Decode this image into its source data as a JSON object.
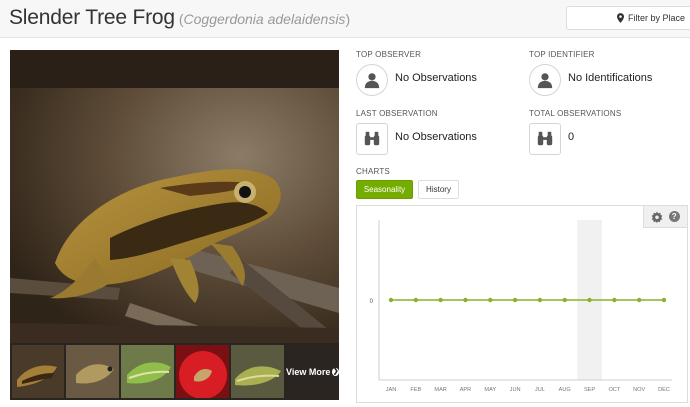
{
  "header": {
    "common_name": "Slender Tree Frog",
    "scientific_name": "Coggerdonia adelaidensis",
    "paren_open": "(",
    "paren_close": ")",
    "filter_label": "Filter by Place"
  },
  "photos": {
    "view_more": "View More",
    "thumbnail_count": 5
  },
  "stats": {
    "top_observer": {
      "label": "TOP OBSERVER",
      "value": "No Observations",
      "icon": "person-icon"
    },
    "top_identifier": {
      "label": "TOP IDENTIFIER",
      "value": "No Identifications",
      "icon": "person-icon"
    },
    "last_observation": {
      "label": "LAST OBSERVATION",
      "value": "No Observations",
      "icon": "binoculars-icon"
    },
    "total_observations": {
      "label": "TOTAL OBSERVATIONS",
      "value": "0",
      "icon": "binoculars-icon"
    }
  },
  "charts": {
    "label": "CHARTS",
    "tabs": [
      {
        "label": "Seasonality",
        "active": true
      },
      {
        "label": "History",
        "active": false
      }
    ]
  },
  "colors": {
    "accent": "#74ac00",
    "line": "#8ab12d",
    "highlight_band": "#f1f1f1"
  },
  "chart_data": {
    "type": "line",
    "categories": [
      "JAN",
      "FEB",
      "MAR",
      "APR",
      "MAY",
      "JUN",
      "JUL",
      "AUG",
      "SEP",
      "OCT",
      "NOV",
      "DEC"
    ],
    "series": [
      {
        "values": [
          0,
          0,
          0,
          0,
          0,
          0,
          0,
          0,
          0,
          0,
          0,
          0
        ]
      }
    ],
    "y_ticks": [
      "0"
    ],
    "highlighted_category": "SEP",
    "grid": false
  }
}
